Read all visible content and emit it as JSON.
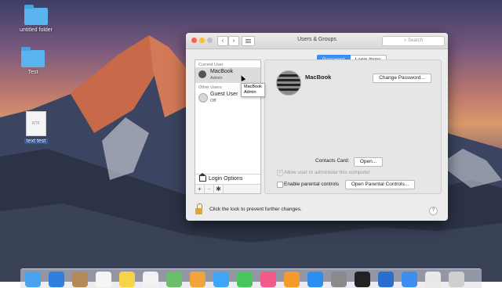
{
  "desktop": {
    "icons": [
      {
        "label": "untitled folder",
        "type": "folder"
      },
      {
        "label": "Test",
        "type": "folder"
      },
      {
        "label": "text test",
        "type": "text-file",
        "file_badge": "RTF"
      }
    ]
  },
  "window": {
    "title": "Users & Groups",
    "nav_back": "‹",
    "nav_forward": "›",
    "search_placeholder": "Search"
  },
  "sidebar": {
    "current_user_header": "Current User",
    "current_user": {
      "name": "MacBook",
      "role": "Admin"
    },
    "other_users_header": "Other Users",
    "other_users": [
      {
        "name": "Guest User",
        "role": "Off"
      }
    ],
    "login_options_label": "Login Options",
    "add_button": "+",
    "remove_button": "−",
    "action_button": "✱"
  },
  "tooltip": {
    "line1": "MacBook",
    "line2": "Admin"
  },
  "tabs": [
    {
      "label": "Password",
      "active": true
    },
    {
      "label": "Login Items",
      "active": false
    }
  ],
  "panel": {
    "user_name": "MacBook",
    "change_password_button": "Change Password...",
    "contacts_card_label": "Contacts Card:",
    "open_button": "Open...",
    "allow_admin_label": "Allow user to administer this computer",
    "allow_admin_checked": true,
    "allow_admin_enabled": false,
    "parental_controls_label": "Enable parental controls",
    "parental_controls_checked": false,
    "open_parental_controls_button": "Open Parental Controls..."
  },
  "footer": {
    "lock_text": "Click the lock to prevent further changes.",
    "help_button": "?"
  },
  "dock": {
    "apps": [
      {
        "icon": "finder-icon",
        "color": "#4aa3f0"
      },
      {
        "icon": "safari-icon",
        "color": "#2f7fe0"
      },
      {
        "icon": "contacts-icon",
        "color": "#b58a5a"
      },
      {
        "icon": "calendar-icon",
        "color": "#f5f5f5"
      },
      {
        "icon": "notes-icon",
        "color": "#f7d34a"
      },
      {
        "icon": "reminders-icon",
        "color": "#f2f2f2"
      },
      {
        "icon": "maps-icon",
        "color": "#6cbf6a"
      },
      {
        "icon": "photos-icon",
        "color": "#f3a33c"
      },
      {
        "icon": "messages-icon",
        "color": "#3fa6f5"
      },
      {
        "icon": "facetime-icon",
        "color": "#4ac75c"
      },
      {
        "icon": "music-icon",
        "color": "#f25a8a"
      },
      {
        "icon": "books-icon",
        "color": "#f59b2d"
      },
      {
        "icon": "app-store-icon",
        "color": "#2e8df0"
      },
      {
        "icon": "system-preferences-icon",
        "color": "#8a8a8a"
      },
      {
        "icon": "terminal-icon",
        "color": "#222222"
      },
      {
        "icon": "network-icon",
        "color": "#2a6fd0"
      },
      {
        "icon": "downloads-icon",
        "color": "#3d8ef0"
      },
      {
        "icon": "document-icon",
        "color": "#e9e9e9"
      },
      {
        "icon": "trash-icon",
        "color": "#cfcfcf"
      }
    ]
  }
}
